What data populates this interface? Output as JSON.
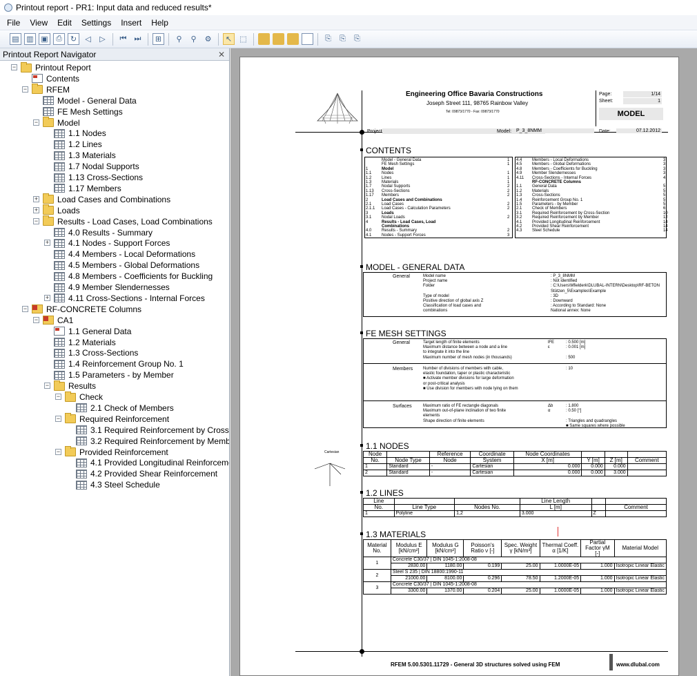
{
  "window": {
    "title": "Printout report - PR1: Input data and reduced results*"
  },
  "menu": [
    "File",
    "View",
    "Edit",
    "Settings",
    "Insert",
    "Help"
  ],
  "navigator": {
    "title": "Printout Report Navigator",
    "items": [
      {
        "label": "Printout Report",
        "level": 0,
        "icon": "folder-icon",
        "expander": "minus"
      },
      {
        "label": "Contents",
        "level": 1,
        "icon": "contents-icon"
      },
      {
        "label": "RFEM",
        "level": 1,
        "icon": "folder-icon",
        "expander": "minus"
      },
      {
        "label": "Model - General Data",
        "level": 2,
        "icon": "table-icon"
      },
      {
        "label": "FE Mesh Settings",
        "level": 2,
        "icon": "table-icon"
      },
      {
        "label": "Model",
        "level": 2,
        "icon": "folder-icon",
        "expander": "minus"
      },
      {
        "label": "1.1 Nodes",
        "level": 3,
        "icon": "table-icon"
      },
      {
        "label": "1.2 Lines",
        "level": 3,
        "icon": "table-icon"
      },
      {
        "label": "1.3 Materials",
        "level": 3,
        "icon": "table-icon"
      },
      {
        "label": "1.7 Nodal Supports",
        "level": 3,
        "icon": "table-icon"
      },
      {
        "label": "1.13 Cross-Sections",
        "level": 3,
        "icon": "table-icon"
      },
      {
        "label": "1.17 Members",
        "level": 3,
        "icon": "table-icon"
      },
      {
        "label": "Load Cases and Combinations",
        "level": 2,
        "icon": "folder-icon",
        "expander": "plus"
      },
      {
        "label": "Loads",
        "level": 2,
        "icon": "folder-icon",
        "expander": "plus"
      },
      {
        "label": "Results - Load Cases, Load Combinations",
        "level": 2,
        "icon": "folder-icon",
        "expander": "minus"
      },
      {
        "label": "4.0 Results - Summary",
        "level": 3,
        "icon": "table-icon"
      },
      {
        "label": "4.1 Nodes - Support Forces",
        "level": 3,
        "icon": "table-icon",
        "expander": "plus"
      },
      {
        "label": "4.4 Members - Local Deformations",
        "level": 3,
        "icon": "table-icon"
      },
      {
        "label": "4.5 Members - Global Deformations",
        "level": 3,
        "icon": "table-icon"
      },
      {
        "label": "4.8 Members - Coefficients for Buckling",
        "level": 3,
        "icon": "table-icon"
      },
      {
        "label": "4.9 Member Slendernesses",
        "level": 3,
        "icon": "table-icon"
      },
      {
        "label": "4.11 Cross-Sections - Internal Forces",
        "level": 3,
        "icon": "table-icon",
        "expander": "plus"
      },
      {
        "label": "RF-CONCRETE Columns",
        "level": 1,
        "icon": "rf-icon",
        "expander": "minus"
      },
      {
        "label": "CA1",
        "level": 2,
        "icon": "rf-icon",
        "expander": "minus"
      },
      {
        "label": "1.1 General Data",
        "level": 3,
        "icon": "contents-icon"
      },
      {
        "label": "1.2 Materials",
        "level": 3,
        "icon": "table-icon"
      },
      {
        "label": "1.3 Cross-Sections",
        "level": 3,
        "icon": "table-icon"
      },
      {
        "label": "1.4 Reinforcement Group No. 1",
        "level": 3,
        "icon": "table-icon"
      },
      {
        "label": "1.5 Parameters - by Member",
        "level": 3,
        "icon": "table-icon"
      },
      {
        "label": "Results",
        "level": 3,
        "icon": "folder-icon",
        "expander": "minus"
      },
      {
        "label": "Check",
        "level": 4,
        "icon": "folder-icon",
        "expander": "minus"
      },
      {
        "label": "2.1 Check of Members",
        "level": 5,
        "icon": "table-icon"
      },
      {
        "label": "Required Reinforcement",
        "level": 4,
        "icon": "folder-icon",
        "expander": "minus"
      },
      {
        "label": "3.1 Required Reinforcement by Cross-Secti",
        "level": 5,
        "icon": "table-icon"
      },
      {
        "label": "3.2 Required Reinforcement by Member",
        "level": 5,
        "icon": "table-icon"
      },
      {
        "label": "Provided Reinforcement",
        "level": 4,
        "icon": "folder-icon",
        "expander": "minus"
      },
      {
        "label": "4.1 Provided Longitudinal Reinforcement",
        "level": 5,
        "icon": "table-icon"
      },
      {
        "label": "4.2 Provided Shear Reinforcement",
        "level": 5,
        "icon": "table-icon"
      },
      {
        "label": "4.3 Steel Schedule",
        "level": 5,
        "icon": "table-icon"
      }
    ]
  },
  "report": {
    "company": "Engineering Office Bavaria Constructions",
    "address": "Joseph Street 111, 98765 Rainbow Valley",
    "phone": "Tel: 09873/1770 - Fax: 09873/1770",
    "page_label": "Page:",
    "page_value": "1/14",
    "sheet_label": "Sheet:",
    "sheet_value": "1",
    "section_title": "MODEL",
    "project_label": "Project:",
    "model_label": "Model:",
    "model_value": "P_3_8NMM",
    "date_label": "Date:",
    "date_value": "07.12.2012",
    "contents_title": "CONTENTS",
    "contents_left": [
      [
        "",
        "Model - General Data",
        "1"
      ],
      [
        "",
        "FE Mesh Settings",
        "1"
      ],
      [
        "1",
        "Model",
        ""
      ],
      [
        "1.1",
        "Nodes",
        "1"
      ],
      [
        "1.2",
        "Lines",
        "1"
      ],
      [
        "1.3",
        "Materials",
        "1"
      ],
      [
        "1.7",
        "Nodal Supports",
        "2"
      ],
      [
        "1.13",
        "Cross-Sections",
        "2"
      ],
      [
        "1.17",
        "Members",
        "2"
      ],
      [
        "2",
        "Load Cases and Combinations",
        ""
      ],
      [
        "2.1",
        "Load Cases",
        "2"
      ],
      [
        "2.1.1",
        "Load Cases - Calculation Parameters",
        "2"
      ],
      [
        "3",
        "Loads",
        ""
      ],
      [
        "3.1",
        "Nodal Loads",
        "2"
      ],
      [
        "4",
        "Results - Load Cases, Load",
        ""
      ],
      [
        "",
        "Combinations",
        ""
      ],
      [
        "4.0",
        "Results - Summary",
        "2"
      ],
      [
        "4.1",
        "Nodes - Support Forces",
        "3"
      ]
    ],
    "contents_right": [
      [
        "4.4",
        "Members - Local Deformations",
        "3"
      ],
      [
        "4.5",
        "Members - Global Deformations",
        "3"
      ],
      [
        "4.8",
        "Members - Coefficients for Buckling",
        "3"
      ],
      [
        "4.9",
        "Member Slendernesses",
        "3"
      ],
      [
        "4.11",
        "Cross-Sections - Internal Forces",
        "4"
      ],
      [
        "",
        "RF-CONCRETE Columns",
        ""
      ],
      [
        "1.1",
        "General Data",
        "5"
      ],
      [
        "1.2",
        "Materials",
        "5"
      ],
      [
        "1.3",
        "Cross-Sections",
        "5"
      ],
      [
        "1.4",
        "Reinforcement Group No. 1",
        "5"
      ],
      [
        "1.5",
        "Parameters - by Member",
        "5"
      ],
      [
        "2.1",
        "Check of Members",
        "6"
      ],
      [
        "3.1",
        "Required Reinforcement by Cross-Section",
        "10"
      ],
      [
        "3.2",
        "Required Reinforcement by Member",
        "12"
      ],
      [
        "4.1",
        "Provided Longitudinal Reinforcement",
        "14"
      ],
      [
        "4.2",
        "Provided Shear Reinforcement",
        "14"
      ],
      [
        "4.3",
        "Steel Schedule",
        "14"
      ]
    ],
    "general_title": "MODEL - GENERAL DATA",
    "general_group": "General",
    "general_rows": [
      [
        "Model name",
        ": P_3_8NMM"
      ],
      [
        "Project name",
        ": Not identified"
      ],
      [
        "Folder",
        ": C:\\Users\\Mfielderk\\DLUBAL-INTERN\\Desktop\\RF-BETON"
      ],
      [
        "",
        "  Stützen_5\\Examples\\Example"
      ],
      [
        "Type of model",
        ": 3D"
      ],
      [
        "Positive direction of global axis Z",
        ": Downward"
      ],
      [
        "Classification of load cases and",
        ": According to Standard: None"
      ],
      [
        "combinations",
        "  National annex: None"
      ]
    ],
    "fe_title": "FE MESH SETTINGS",
    "fe_general": "General",
    "fe_members": "Members",
    "fe_surfaces": "Surfaces",
    "fe_general_rows": [
      [
        "Target length of finite elements",
        "lFE",
        ": 0.500 [m]"
      ],
      [
        "Maximum distance between a node and a line",
        "ε",
        ": 0.001 [m]"
      ],
      [
        "to integrate it into the line",
        "",
        ""
      ],
      [
        "Maximum number of mesh nodes (in thousands)",
        "",
        ": 500"
      ]
    ],
    "fe_members_rows": [
      [
        "Number of divisions of members with cable,",
        ": 10"
      ],
      [
        "elastic foundation, taper or plastic characteristic",
        ""
      ],
      [
        "■ Activate member divisions for large deformation",
        ""
      ],
      [
        "  or post-critical analysis",
        ""
      ],
      [
        "■ Use division for members with node lying on them",
        ""
      ]
    ],
    "fe_surfaces_rows": [
      [
        "Maximum ratio of FE rectangle diagonals",
        "Δb",
        ": 1.800"
      ],
      [
        "Maximum out-of-plane inclination of two finite",
        "α",
        ": 0.50 [°]"
      ],
      [
        "elements",
        "",
        ""
      ],
      [
        "Shape direction of finite elements",
        "",
        ": Triangles and quadrangles"
      ],
      [
        "",
        "",
        "■ Same squares where possible"
      ]
    ],
    "nodes_title": "1.1 NODES",
    "nodes_header_top": [
      "Node",
      "",
      "Reference",
      "Coordinate",
      "Node Coordinates",
      "",
      "",
      ""
    ],
    "nodes_header": [
      "No.",
      "Node Type",
      "Node",
      "System",
      "X [m]",
      "Y [m]",
      "Z [m]",
      "Comment"
    ],
    "nodes_rows": [
      [
        "1",
        "Standard",
        "-",
        "Cartesian",
        "0.000",
        "0.000",
        "0.000",
        ""
      ],
      [
        "2",
        "Standard",
        "-",
        "Cartesian",
        "0.000",
        "0.000",
        "3.000",
        ""
      ]
    ],
    "coord_label": "Cartesian",
    "lines_title": "1.2 LINES",
    "lines_header_top": [
      "Line",
      "",
      "",
      "Line Length",
      "",
      ""
    ],
    "lines_header": [
      "No.",
      "Line Type",
      "Nodes No.",
      "L [m]",
      "",
      "Comment"
    ],
    "lines_rows": [
      [
        "1",
        "Polyline",
        "1,2",
        "3.000",
        "Z",
        ""
      ]
    ],
    "materials_title": "1.3 MATERIALS",
    "materials_header": [
      "Material No.",
      "Modulus E [kN/cm²]",
      "Modulus G [kN/cm²]",
      "Poisson's Ratio ν [-]",
      "Spec. Weight γ [kN/m³]",
      "Thermal Coeff. α [1/K]",
      "Partial Factor γM [-]",
      "Material Model"
    ],
    "materials_rows": [
      {
        "no": "1",
        "name": "Concrete C30/37 | DIN 1045-1:2008-08",
        "e": "2830.00",
        "g": "1180.00",
        "nu": "0.199",
        "gamma": "25.00",
        "alpha": "1.0000E-05",
        "gm": "1.000",
        "model": "Isotropic Linear Elastic"
      },
      {
        "no": "2",
        "name": "Steel S 235 | DIN 18800:1990-11",
        "e": "21000.00",
        "g": "8100.00",
        "nu": "0.296",
        "gamma": "78.50",
        "alpha": "1.2000E-05",
        "gm": "1.000",
        "model": "Isotropic Linear Elastic"
      },
      {
        "no": "3",
        "name": "Concrete C30/37 | DIN 1045-1:2008-08",
        "e": "3300.00",
        "g": "1370.00",
        "nu": "0.204",
        "gamma": "25.00",
        "alpha": "1.0000E-05",
        "gm": "1.000",
        "model": "Isotropic Linear Elastic"
      }
    ],
    "footer_text": "RFEM 5.00.5301.11729 - General 3D structures solved using FEM",
    "footer_url": "www.dlubal.com"
  },
  "colors": {
    "accent": "#3b5f8a",
    "folder": "#f2cb58",
    "workspace": "#a9a9a9"
  }
}
